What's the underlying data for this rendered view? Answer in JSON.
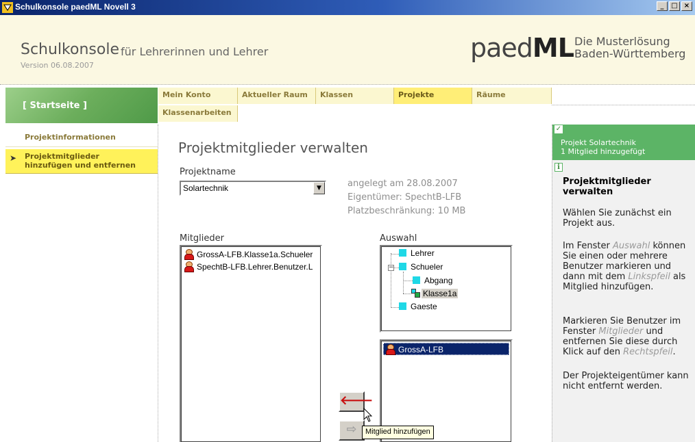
{
  "window": {
    "title": "Schulkonsole paedML Novell 3",
    "minimize": "_",
    "maximize": "□",
    "close": "×"
  },
  "header": {
    "title": "Schulkonsole",
    "subtitle": "für Lehrerinnen und Lehrer",
    "version": "Version 06.08.2007",
    "logo_light": "paed",
    "logo_bold": "ML",
    "slogan_line1": "Die Musterlösung",
    "slogan_line2": "Baden-Württemberg"
  },
  "start": {
    "label": "[ Startseite ]"
  },
  "nav": {
    "tabs": [
      {
        "label": "Mein Konto",
        "active": false
      },
      {
        "label": "Aktueller Raum",
        "active": false
      },
      {
        "label": "Klassen",
        "active": false
      },
      {
        "label": "Projekte",
        "active": true
      },
      {
        "label": "Räume",
        "active": false
      },
      {
        "label": "Klassenarbeiten",
        "active": false
      }
    ]
  },
  "sidebar": {
    "items": [
      {
        "label": "Projektinformationen",
        "active": false
      },
      {
        "label": "Projektmitglieder\nhinzufügen und entfernen",
        "active": true
      }
    ]
  },
  "main": {
    "title": "Projektmitglieder verwalten",
    "project_label": "Projektname",
    "project_value": "Solartechnik",
    "created": "angelegt am 28.08.2007",
    "owner": "Eigentümer: SpechtB-LFB",
    "quota": "Platzbeschränkung: 10 MB",
    "members_label": "Mitglieder",
    "members": [
      "GrossA-LFB.Klasse1a.Schueler",
      "SpechtB-LFB.Lehrer.Benutzer.L"
    ],
    "selection_label": "Auswahl",
    "tree": {
      "lehrer": "Lehrer",
      "schueler": "Schueler",
      "abgang": "Abgang",
      "klasse": "Klasse1a",
      "gaeste": "Gaeste"
    },
    "selected_user": "GrossA-LFB",
    "add_arrow": "🡐",
    "remove_arrow": "⇨",
    "tooltip": "Mitglied hinzufügen"
  },
  "right": {
    "notice_line1": "Projekt Solartechnik",
    "notice_line2": "1 Mitglied hinzugefügt",
    "help_title": "Projektmitglieder verwalten",
    "help_p1": "Wählen Sie zunächst ein Projekt aus.",
    "help_p2a": "Im Fenster ",
    "help_p2b": "Auswahl",
    "help_p2c": " können Sie einen oder mehrere Benutzer markieren und dann mit dem ",
    "help_p2d": "Linkspfeil",
    "help_p2e": " als Mitglied hinzufügen.",
    "help_p3a": "Markieren Sie Benutzer im Fenster ",
    "help_p3b": "Mitglieder",
    "help_p3c": " und entfernen Sie diese durch Klick auf den ",
    "help_p3d": "Rechtspfeil",
    "help_p3e": ".",
    "help_p4": "Der Projekteigentümer kann nicht entfernt werden."
  },
  "colors": {
    "accent": "#fff25a",
    "notice": "#5cb466",
    "selection": "#0a246a"
  }
}
